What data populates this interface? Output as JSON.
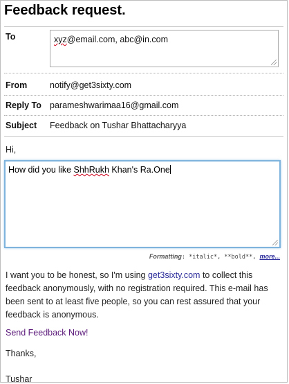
{
  "title": "Feedback request.",
  "fields": {
    "to": {
      "label": "To",
      "value": "xyz@email.com, abc@in.com",
      "value_misspelled": "xyz",
      "value_rest": "@email.com, abc@in.com"
    },
    "from": {
      "label": "From",
      "value": "notify@get3sixty.com"
    },
    "reply_to": {
      "label": "Reply To",
      "value": "parameshwarimaa16@gmail.com"
    },
    "subject": {
      "label": "Subject",
      "value": "Feedback on Tushar Bhattacharyya"
    }
  },
  "greeting": "Hi,",
  "message": {
    "before": "How did you like ",
    "misspelled": "ShhRukh",
    "after": " Khan's Ra.One"
  },
  "formatting": {
    "label": "Formatting",
    "hint": ": *italic*, **bold**, ",
    "more_link": "more..."
  },
  "body": {
    "part1": "I want you to be honest, so I'm using ",
    "link": "get3sixty.com",
    "part2": " to collect this feedback anonymously, with no registration required. This e-mail has been sent to at least five people, so you can rest assured that your feedback is anonymous."
  },
  "send_link": "Send Feedback Now!",
  "closing": "Thanks,",
  "signature": "Tushar"
}
